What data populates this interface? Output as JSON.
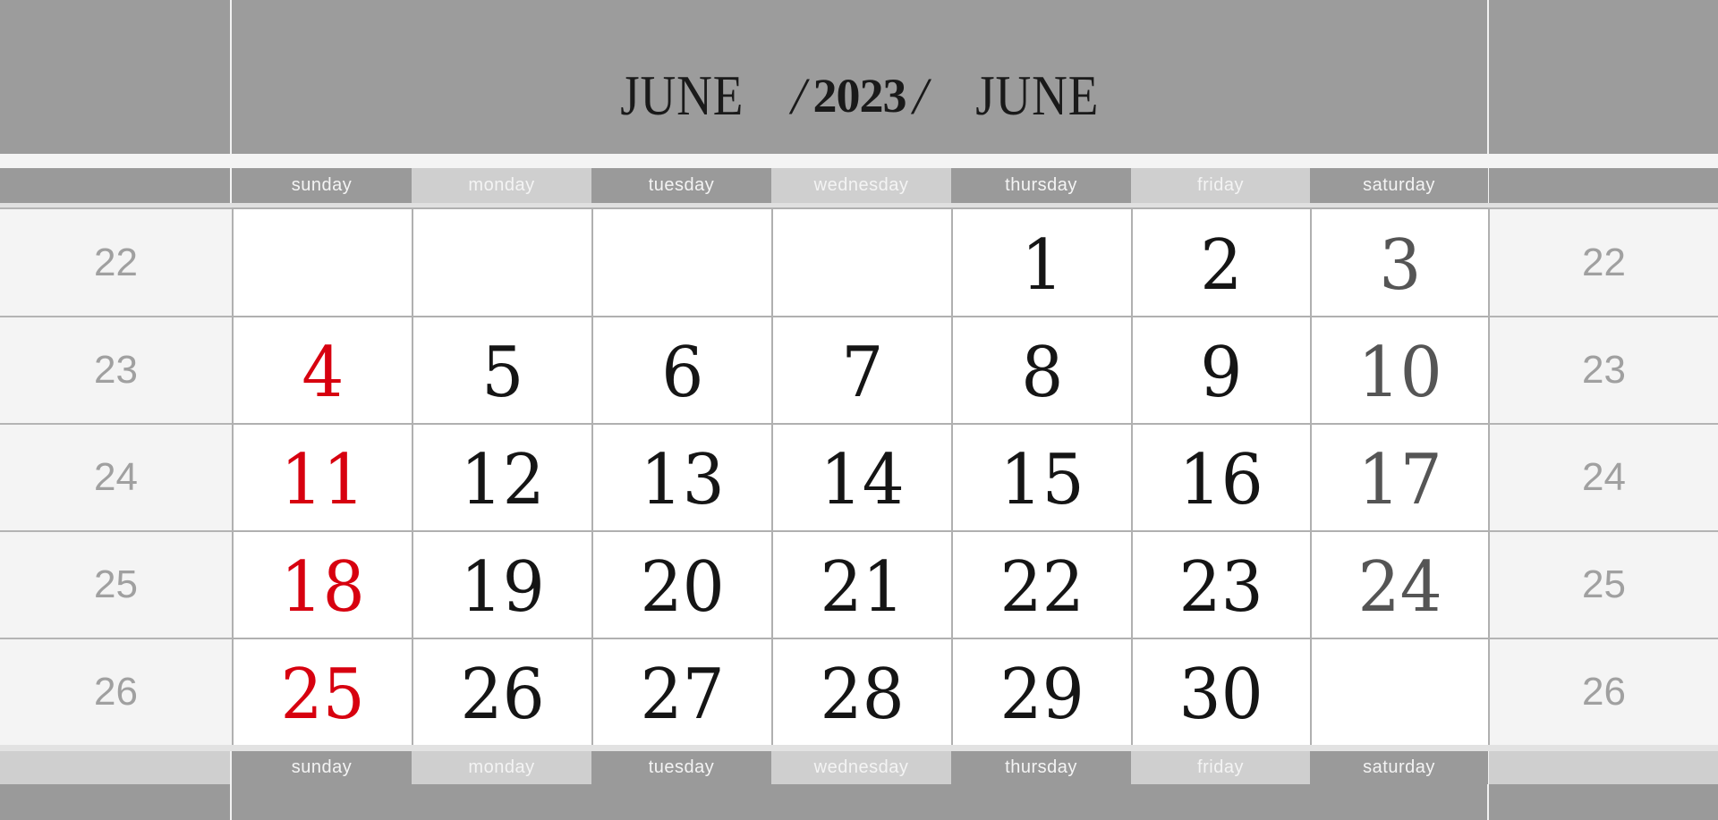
{
  "title": {
    "month_left": "JUNE",
    "separator": "/",
    "year": "2023",
    "month_right": "JUNE"
  },
  "weekdays": [
    "sunday",
    "monday",
    "tuesday",
    "wednesday",
    "thursday",
    "friday",
    "saturday"
  ],
  "weeks": [
    {
      "number": "22",
      "days": [
        "",
        "",
        "",
        "",
        "1",
        "2",
        "3"
      ]
    },
    {
      "number": "23",
      "days": [
        "4",
        "5",
        "6",
        "7",
        "8",
        "9",
        "10"
      ]
    },
    {
      "number": "24",
      "days": [
        "11",
        "12",
        "13",
        "14",
        "15",
        "16",
        "17"
      ]
    },
    {
      "number": "25",
      "days": [
        "18",
        "19",
        "20",
        "21",
        "22",
        "23",
        "24"
      ]
    },
    {
      "number": "26",
      "days": [
        "25",
        "26",
        "27",
        "28",
        "29",
        "30",
        ""
      ]
    }
  ],
  "colors": {
    "band_grey": "#9c9c9c",
    "header_light": "#cfcfcf",
    "sunday_red": "#d7000f",
    "saturday_grey": "#555555",
    "weekday_black": "#151515",
    "week_number_grey": "#a0a0a0"
  }
}
